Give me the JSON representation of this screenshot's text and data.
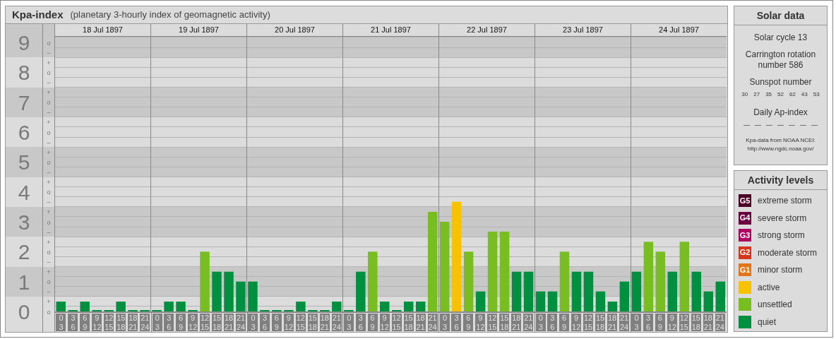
{
  "kpa_panel": {
    "title": "Kpa-index",
    "subtitle": "(planetary 3-hourly index of geomagnetic activity)",
    "days": [
      "18 Jul 1897",
      "19 Jul 1897",
      "20 Jul 1897",
      "21 Jul 1897",
      "22 Jul 1897",
      "23 Jul 1897",
      "24 Jul 1897"
    ],
    "sublevel_labels": [
      "o",
      "–",
      "+",
      "o",
      "–",
      "+",
      "o",
      "–",
      "+",
      "o",
      "–",
      "+",
      "o",
      "–",
      "+",
      "o",
      "–",
      "+",
      "o",
      "–",
      "+",
      "o",
      "–",
      "+",
      "o",
      "–",
      "+",
      "o"
    ],
    "chart_data": {
      "type": "bar",
      "categories": [
        "0 3",
        "3 6",
        "6 9",
        "9 12",
        "12 15",
        "15 18",
        "18 21",
        "21 24",
        "0 3",
        "3 6",
        "6 9",
        "9 12",
        "12 15",
        "15 18",
        "18 21",
        "21 24",
        "0 3",
        "3 6",
        "6 9",
        "9 12",
        "12 15",
        "15 18",
        "18 21",
        "21 24",
        "0 3",
        "3 6",
        "6 9",
        "9 12",
        "12 15",
        "15 18",
        "18 21",
        "21 24",
        "0 3",
        "3 6",
        "6 9",
        "9 12",
        "12 15",
        "15 18",
        "18 21",
        "21 24",
        "0 3",
        "3 6",
        "6 9",
        "9 12",
        "12 15",
        "15 18",
        "18 21",
        "21 24",
        "0 3",
        "3 6",
        "6 9",
        "9 12",
        "12 15",
        "15 18",
        "18 21",
        "21 24"
      ],
      "series": [
        {
          "values": [
            0.33,
            0,
            0.33,
            0,
            0,
            0.33,
            0,
            0,
            0,
            0.33,
            0.33,
            0,
            2,
            1.33,
            1.33,
            1,
            1,
            0,
            0,
            0,
            0.33,
            0,
            0,
            0.33,
            0,
            1.33,
            2,
            0.33,
            0,
            0.33,
            0.33,
            3.33,
            3,
            3.67,
            2,
            0.67,
            2.67,
            2.67,
            1.33,
            1.33,
            0.67,
            0.67,
            2,
            1.33,
            1.33,
            0.67,
            0.33,
            1,
            1.33,
            2.33,
            2,
            1.33,
            2.33,
            1.33,
            0.67,
            1
          ]
        }
      ],
      "ylim": [
        0,
        9.19
      ],
      "yticks": [
        {
          "value": 0,
          "label": "0"
        },
        {
          "value": 1,
          "label": "1"
        },
        {
          "value": 2,
          "label": "2"
        },
        {
          "value": 3,
          "label": "3"
        },
        {
          "value": 4,
          "label": "4"
        },
        {
          "value": 5,
          "label": "5"
        },
        {
          "value": 6,
          "label": "6"
        },
        {
          "value": 7,
          "label": "7"
        },
        {
          "value": 8,
          "label": "8"
        },
        {
          "value": 9,
          "label": "9"
        }
      ]
    }
  },
  "solar_data": {
    "title": "Solar data",
    "solar_cycle": "Solar cycle 13",
    "carrington": "Carrington rotation number 586",
    "sunspot_label": "Sunspot number",
    "sunspot_numbers": [
      "30",
      "27",
      "35",
      "52",
      "62",
      "43",
      "53"
    ],
    "ap_label": "Daily Ap-index",
    "ap_values": [
      "—",
      "—",
      "—",
      "—",
      "—",
      "—",
      "—"
    ],
    "source": "Kpa-data from NOAA NCEI:",
    "source_url": "http://www.ngdc.noaa.gov/"
  },
  "activity_levels": {
    "title": "Activity levels",
    "items": [
      {
        "badge": "G5",
        "label": "extreme storm",
        "color": "#4d0026"
      },
      {
        "badge": "G4",
        "label": "severe storm",
        "color": "#6b0040"
      },
      {
        "badge": "G3",
        "label": "strong storm",
        "color": "#ae0060"
      },
      {
        "badge": "G2",
        "label": "moderate storm",
        "color": "#d8361c"
      },
      {
        "badge": "G1",
        "label": "minor storm",
        "color": "#e3761a"
      },
      {
        "label": "active",
        "color": "#f7c300"
      },
      {
        "label": "unsettled",
        "color": "#78be20"
      },
      {
        "label": "quiet",
        "color": "#009040"
      }
    ]
  }
}
